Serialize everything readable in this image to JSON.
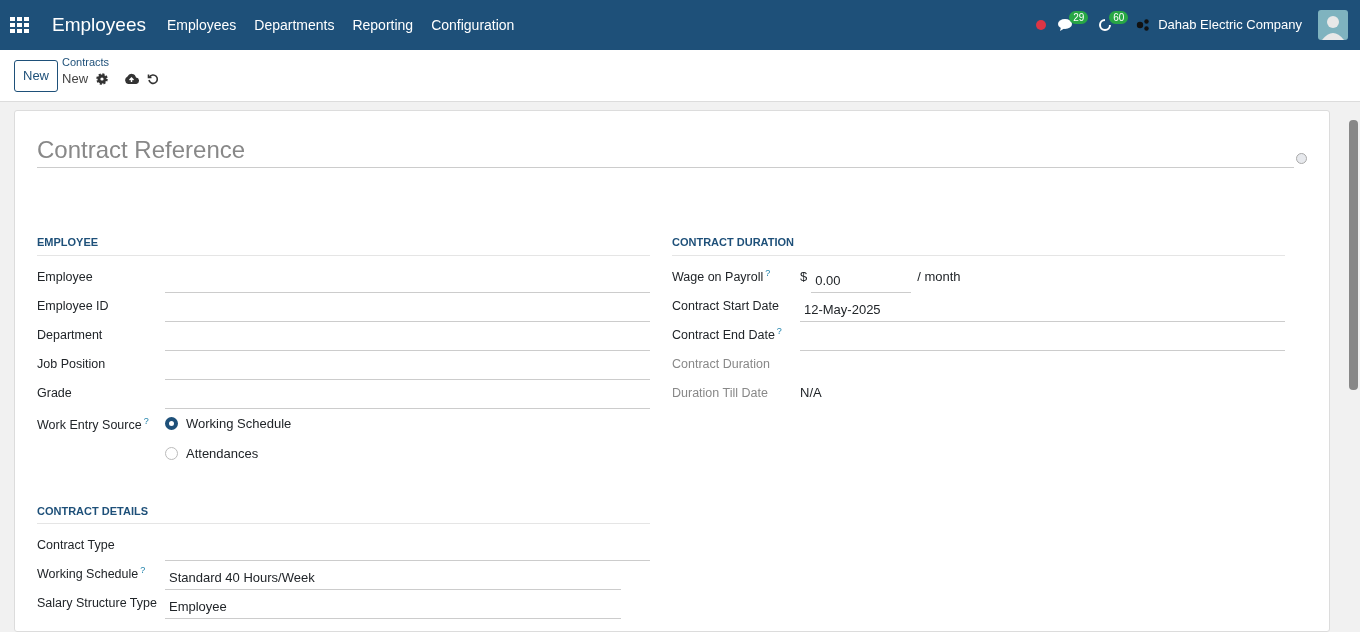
{
  "navbar": {
    "app_title": "Employees",
    "menu": [
      "Employees",
      "Departments",
      "Reporting",
      "Configuration"
    ],
    "messages_count": "29",
    "activities_count": "60",
    "company": "Dahab Electric Company"
  },
  "control_panel": {
    "new_button": "New",
    "breadcrumb": "Contracts",
    "record": "New"
  },
  "form": {
    "reference_placeholder": "Contract Reference",
    "left_sections": [
      {
        "title": "EMPLOYEE",
        "fields": [
          {
            "kind": "input",
            "label": "Employee"
          },
          {
            "kind": "input",
            "label": "Employee ID"
          },
          {
            "kind": "input",
            "label": "Department"
          },
          {
            "kind": "input",
            "label": "Job Position"
          },
          {
            "kind": "input",
            "label": "Grade"
          },
          {
            "kind": "radio",
            "label": "Work Entry Source",
            "help": "?",
            "options": [
              {
                "label": "Working Schedule",
                "selected": true
              },
              {
                "label": "Attendances",
                "selected": false
              }
            ]
          }
        ]
      },
      {
        "title": "CONTRACT DETAILS",
        "fields": [
          {
            "kind": "input",
            "label": "Contract Type"
          },
          {
            "kind": "input",
            "label": "Working Schedule",
            "help": "?",
            "value": "Standard 40 Hours/Week",
            "short": true
          },
          {
            "kind": "input",
            "label": "Salary Structure Type",
            "value": "Employee",
            "short": true
          }
        ]
      }
    ],
    "right_sections": [
      {
        "title": "CONTRACT DURATION",
        "fields": [
          {
            "kind": "money",
            "label": "Wage on Payroll",
            "help": "?",
            "prefix": "$",
            "value": "0.00",
            "suffix": "/ month"
          },
          {
            "kind": "input",
            "label": "Contract Start Date",
            "value": "12-May-2025"
          },
          {
            "kind": "input",
            "label": "Contract End Date",
            "help": "?"
          },
          {
            "kind": "readonly",
            "label": "Contract Duration"
          },
          {
            "kind": "readonly",
            "label": "Duration Till Date",
            "value": "N/A"
          }
        ]
      }
    ]
  }
}
